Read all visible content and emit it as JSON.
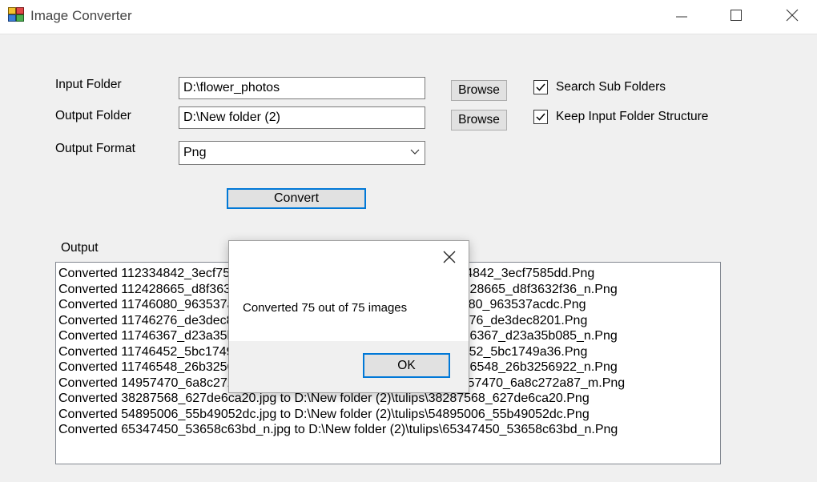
{
  "window": {
    "title": "Image Converter"
  },
  "form": {
    "input_folder_label": "Input Folder",
    "input_folder_value": "D:\\flower_photos",
    "output_folder_label": "Output Folder",
    "output_folder_value": "D:\\New folder (2)",
    "output_format_label": "Output Format",
    "output_format_value": "Png",
    "browse_label": "Browse",
    "search_sub_folders_label": "Search Sub Folders",
    "search_sub_folders_checked": true,
    "keep_structure_label": "Keep Input Folder Structure",
    "keep_structure_checked": true,
    "convert_label": "Convert"
  },
  "output": {
    "label": "Output",
    "lines": [
      "Converted 112334842_3ecf7585dd.jpg to D:\\New folder (2)\\tulips\\112334842_3ecf7585dd.Png",
      "Converted 112428665_d8f3632f36_n.jpg to D:\\New folder (2)\\tulips\\112428665_d8f3632f36_n.Png",
      "Converted 11746080_963537acdc.jpg to D:\\New folder (2)\\tulips\\11746080_963537acdc.Png",
      "Converted 11746276_de3dec8201.jpg to D:\\New folder (2)\\tulips\\11746276_de3dec8201.Png",
      "Converted 11746367_d23a35b085_n.jpg to D:\\New folder (2)\\tulips\\11746367_d23a35b085_n.Png",
      "Converted 11746452_5bc1749a36.jpg to D:\\New folder (2)\\tulips\\11746452_5bc1749a36.Png",
      "Converted 11746548_26b3256922_n.jpg to D:\\New folder (2)\\tulips\\11746548_26b3256922_n.Png",
      "Converted 14957470_6a8c272a87_m.jpg to D:\\New folder (2)\\tulips\\14957470_6a8c272a87_m.Png",
      "Converted 38287568_627de6ca20.jpg to D:\\New folder (2)\\tulips\\38287568_627de6ca20.Png",
      "Converted 54895006_55b49052dc.jpg to D:\\New folder (2)\\tulips\\54895006_55b49052dc.Png",
      "Converted 65347450_53658c63bd_n.jpg to D:\\New folder (2)\\tulips\\65347450_53658c63bd_n.Png"
    ]
  },
  "dialog": {
    "message": "Converted 75 out of 75 images",
    "ok_label": "OK"
  },
  "colors": {
    "accent": "#0078d7",
    "window_bg": "#f0f0f0",
    "button_bg": "#e1e1e1"
  },
  "icons": [
    "app-icon",
    "minimize-icon",
    "maximize-icon",
    "close-icon",
    "checkmark-icon",
    "chevron-down-icon",
    "dialog-close-icon"
  ]
}
